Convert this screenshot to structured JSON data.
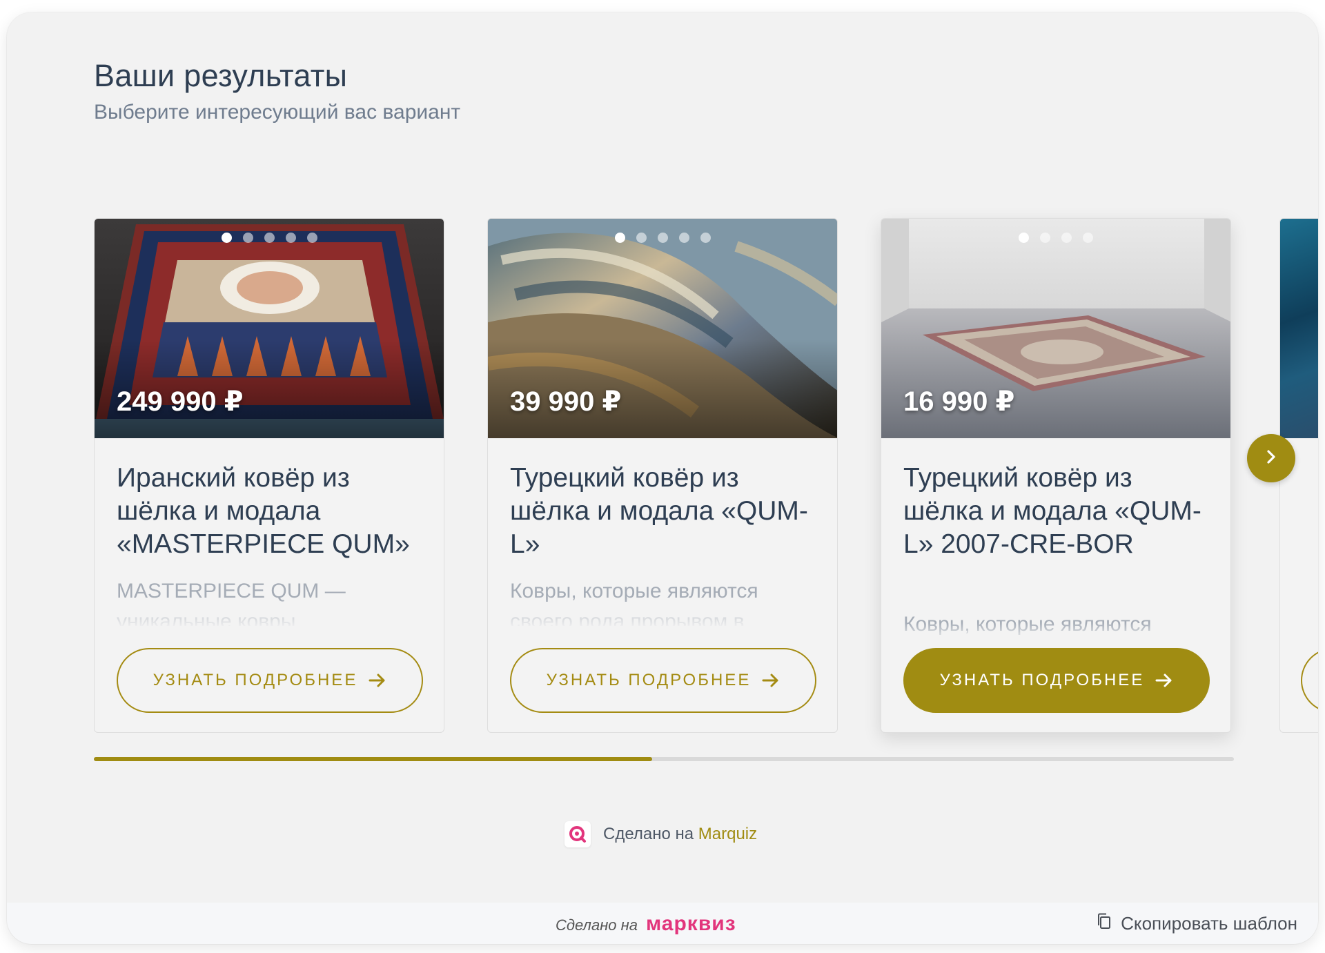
{
  "page": {
    "title": "Ваши результаты",
    "subtitle": "Выберите интересующий вас вариант"
  },
  "cards": [
    {
      "price": "249 990 ₽",
      "title": "Иранский ковёр из шёлка и модала «MASTERPIECE QUM»",
      "description": "MASTERPIECE QUM — уникальные ковры",
      "button_label": "УЗНАТЬ ПОДРОБНЕЕ",
      "slide_count": 5,
      "active_slide": 1,
      "button_style": "outline"
    },
    {
      "price": "39 990 ₽",
      "title": "Турецкий ковёр из шёлка и модала «QUM-L»",
      "description": "Ковры, которые являются своего рода прорывом в",
      "button_label": "УЗНАТЬ ПОДРОБНЕЕ",
      "slide_count": 5,
      "active_slide": 1,
      "button_style": "outline"
    },
    {
      "price": "16 990 ₽",
      "title": "Турецкий ковёр из шёлка и модала «QUM-L» 2007-CRE-BOR",
      "description": "Ковры, которые являются",
      "button_label": "УЗНАТЬ ПОДРОБНЕЕ",
      "slide_count": 4,
      "active_slide": 1,
      "button_style": "filled"
    }
  ],
  "carousel": {
    "next_icon": "chevron-right-icon",
    "progress": 0.49
  },
  "footer": {
    "made_with_text": "Сделано на",
    "made_with_link": "Marquiz",
    "bar_made_text": "Сделано на",
    "bar_brand": "марквиз",
    "copy_template_label": "Скопировать шаблон",
    "copy_icon": "copy-icon"
  },
  "colors": {
    "accent": "#a08c12",
    "title": "#2e3e52",
    "subtitle": "#6f7c8e",
    "brand_pink": "#e2357c",
    "background": "#f2f2f2"
  }
}
